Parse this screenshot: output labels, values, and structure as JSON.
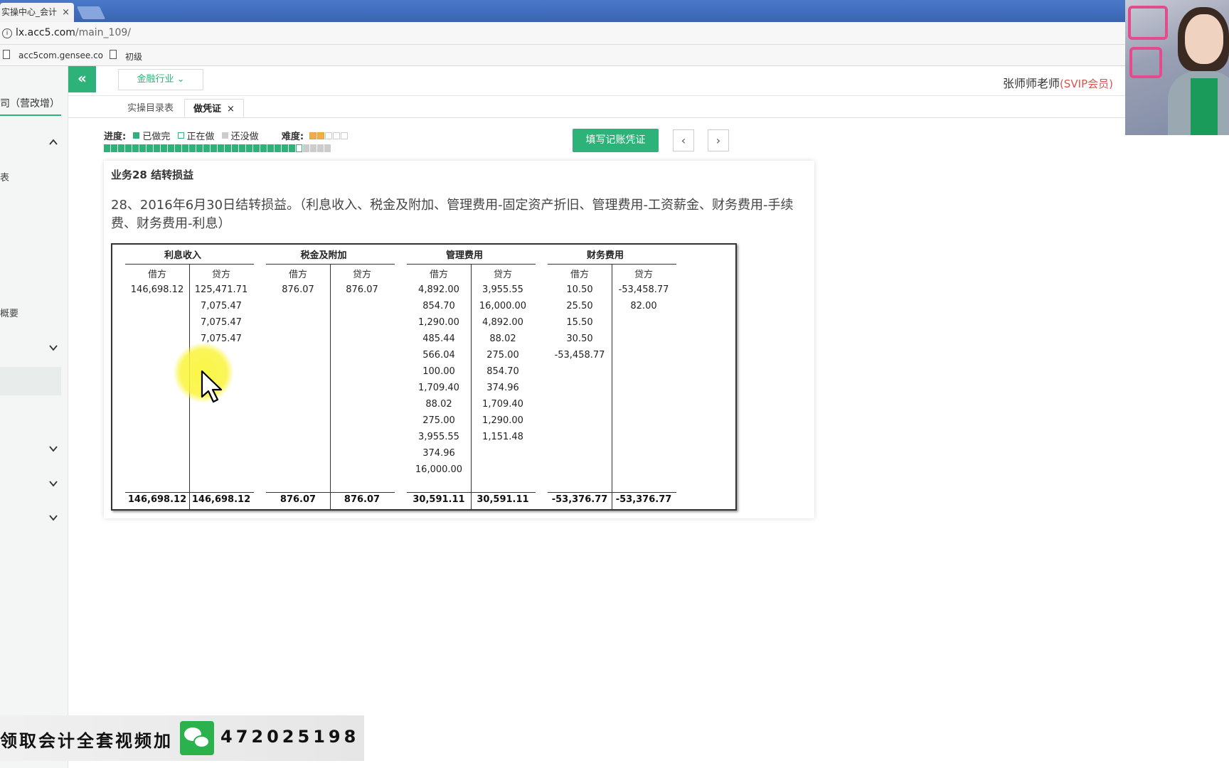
{
  "browser": {
    "tab_title": "实操中心_会计",
    "tab_close": "×",
    "url_host": "lx.acc5.com",
    "url_path": "/main_109/",
    "bookmarks": [
      "acc5com.gensee.co",
      "初级"
    ]
  },
  "header": {
    "collapse_icon": "«",
    "industry": "金融行业 ⌄",
    "user": "张师师老师",
    "vip": "(SVIP会员)"
  },
  "sidebar": {
    "title": "司（营改增）",
    "item_1": "表",
    "item_2": "概要"
  },
  "tabs": [
    {
      "label": "实操目录表"
    },
    {
      "label": "做凭证",
      "close": "×"
    }
  ],
  "progress": {
    "label": "进度:",
    "done": "已做完",
    "doing": "正在做",
    "todo": "还没做",
    "difficulty_label": "难度:",
    "difficulty_level": 2,
    "difficulty_max": 5,
    "done_count": 27,
    "current_index": 28,
    "total_count": 32
  },
  "actions": {
    "fill_voucher": "填写记账凭证",
    "prev": "‹",
    "next": "›"
  },
  "task": {
    "title": "业务28 结转损益",
    "description": "28、2016年6月30日结转损益。（利息收入、税金及附加、管理费用-固定资产折旧、管理费用-工资薪金、财务费用-手续费、财务费用-利息）"
  },
  "ledger": {
    "debit_label": "借方",
    "credit_label": "贷方",
    "accounts": [
      {
        "name": "利息收入",
        "debit": [
          "146,698.12"
        ],
        "credit": [
          "125,471.71",
          "7,075.47",
          "7,075.47",
          "7,075.47"
        ],
        "debit_total": "146,698.12",
        "credit_total": "146,698.12"
      },
      {
        "name": "税金及附加",
        "debit": [
          "876.07"
        ],
        "credit": [
          "876.07"
        ],
        "debit_total": "876.07",
        "credit_total": "876.07"
      },
      {
        "name": "管理费用",
        "debit": [
          "4,892.00",
          "854.70",
          "1,290.00",
          "485.44",
          "566.04",
          "100.00",
          "1,709.40",
          "88.02",
          "275.00",
          "3,955.55",
          "374.96",
          "16,000.00"
        ],
        "credit": [
          "3,955.55",
          "16,000.00",
          "4,892.00",
          "88.02",
          "275.00",
          "854.70",
          "374.96",
          "1,709.40",
          "1,290.00",
          "1,151.48"
        ],
        "debit_total": "30,591.11",
        "credit_total": "30,591.11"
      },
      {
        "name": "财务费用",
        "debit": [
          "10.50",
          "25.50",
          "15.50",
          "30.50",
          "-53,458.77"
        ],
        "credit": [
          "-53,458.77",
          "82.00"
        ],
        "debit_total": "-53,376.77",
        "credit_total": "-53,376.77"
      }
    ]
  },
  "banner": {
    "text": "领取会计全套视频加",
    "number": "472025198"
  }
}
